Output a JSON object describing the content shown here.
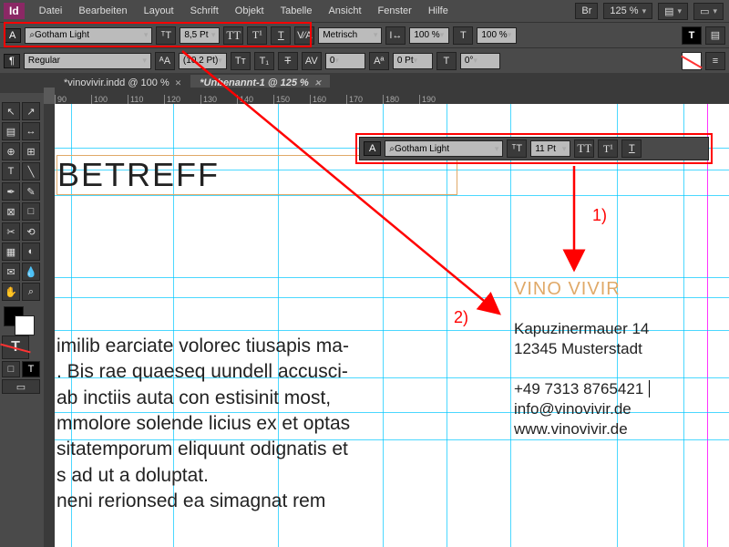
{
  "app_id": "Id",
  "menu": [
    "Datei",
    "Bearbeiten",
    "Layout",
    "Schrift",
    "Objekt",
    "Tabelle",
    "Ansicht",
    "Fenster",
    "Hilfe"
  ],
  "top_right": {
    "br": "Br",
    "zoom": "125 %"
  },
  "ctrl_row1": {
    "font": "Gotham Light",
    "size": "8,5 Pt",
    "metrics": "Metrisch",
    "h100": "100 %",
    "v100": "100 %"
  },
  "ctrl_row2": {
    "style": "Regular",
    "leading": "(10,2 Pt)",
    "track": "0",
    "pt0": "0 Pt"
  },
  "tabs": [
    {
      "label": "*vinovivir.indd @ 100 %",
      "active": false
    },
    {
      "label": "*Unbenannt-1 @ 125 %",
      "active": true
    }
  ],
  "ruler_ticks": [
    "90",
    "100",
    "110",
    "120",
    "130",
    "140",
    "150",
    "160",
    "170",
    "180",
    "190"
  ],
  "float_toolbar": {
    "font": "Gotham Light",
    "size": "11 Pt"
  },
  "document": {
    "heading": "BETREFF",
    "body": "imilib earciate volorec tiusapis ma-\n. Bis rae quaeseq uundell accusci-\nab inctiis auta con estisinit most,\nmmolore solende licius ex et optas\nsitatemporum eliquunt odignatis et\ns ad ut a doluptat.\nneni rerionsed ea simagnat rem",
    "company": "VINO VIVIR",
    "addr1": "Kapuzinermauer 14",
    "addr2": "12345 Musterstadt",
    "phone": "+49 7313 8765421",
    "email": "info@vinovivir.de",
    "web": "www.vinovivir.de"
  },
  "annotations": {
    "a1": "1)",
    "a2": "2)"
  },
  "icons": {
    "search": "⌕",
    "chevron": "▾",
    "A": "A",
    "para": "¶",
    "TT": "TT",
    "VA": "V⁄A",
    "AV": "AV",
    "Tv": "T",
    "arrow": "↕",
    "pointer": "▲",
    "direct": "▷",
    "pen": "✒",
    "type": "T",
    "line": "╲",
    "rect": "□",
    "scissors": "✂",
    "rotate": "⟲",
    "eyedrop": "✎",
    "hand": "✋",
    "zoom": "⌕",
    "grad": "▦",
    "note": "✎"
  }
}
